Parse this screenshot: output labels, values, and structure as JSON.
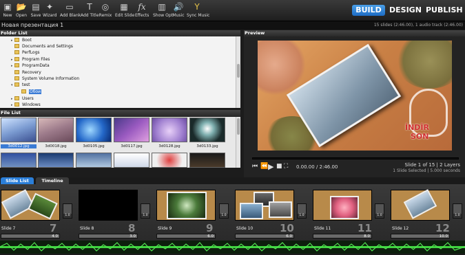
{
  "toolbar": {
    "buttons": [
      {
        "label": "New",
        "icon": "new-icon"
      },
      {
        "label": "Open",
        "icon": "open-icon"
      },
      {
        "label": "Save",
        "icon": "save-icon"
      },
      {
        "label": "Wizard",
        "icon": "wizard-icon"
      },
      {
        "label": "Add Blank",
        "icon": "add-blank-icon"
      },
      {
        "label": "Add Title",
        "icon": "add-title-icon"
      },
      {
        "label": "Remix",
        "icon": "remix-icon"
      },
      {
        "label": "Edit Slide",
        "icon": "edit-slide-icon"
      },
      {
        "label": "Effects",
        "icon": "effects-icon"
      },
      {
        "label": "Show Opt",
        "icon": "show-options-icon"
      },
      {
        "label": "Music",
        "icon": "music-icon"
      },
      {
        "label": "Sync Music",
        "icon": "sync-music-icon"
      }
    ],
    "modes": [
      {
        "label": "BUILD",
        "active": true
      },
      {
        "label": "DESIGN",
        "active": false
      },
      {
        "label": "PUBLISH",
        "active": false
      }
    ]
  },
  "project": {
    "title": "Новая презентация 1",
    "summary": "15 slides (2:46.00), 1 audio track (2:46.00)"
  },
  "folder_list": {
    "header": "Folder List",
    "items": [
      {
        "label": "Boot",
        "expandable": true,
        "selected": false
      },
      {
        "label": "Documents and Settings",
        "expandable": false,
        "selected": false
      },
      {
        "label": "PerfLogs",
        "expandable": false,
        "selected": false
      },
      {
        "label": "Program Files",
        "expandable": true,
        "selected": false
      },
      {
        "label": "ProgramData",
        "expandable": true,
        "selected": false
      },
      {
        "label": "Recovery",
        "expandable": false,
        "selected": false
      },
      {
        "label": "System Volume Information",
        "expandable": false,
        "selected": false
      },
      {
        "label": "test",
        "expandable": true,
        "selected": false
      },
      {
        "label": "Обои",
        "expandable": false,
        "selected": true
      },
      {
        "label": "Users",
        "expandable": true,
        "selected": false
      },
      {
        "label": "Windows",
        "expandable": true,
        "selected": false
      }
    ]
  },
  "file_list": {
    "header": "File List",
    "files": [
      {
        "name": "3d0012.jpg",
        "selected": true
      },
      {
        "name": "3d0018.jpg",
        "selected": false
      },
      {
        "name": "3d0105.jpg",
        "selected": false
      },
      {
        "name": "3d0117.jpg",
        "selected": false
      },
      {
        "name": "3d0128.jpg",
        "selected": false
      },
      {
        "name": "3d0133.jpg",
        "selected": false
      }
    ]
  },
  "preview": {
    "header": "Preview",
    "watermark_line1": "İNDİR",
    "watermark_line2": "SON",
    "time": "0.00.00 / 2:46.00",
    "slide_info": "Slide 1 of 15  |  2 Layers",
    "selection_info": "1 Slide Selected  |  5.000 seconds"
  },
  "tabs": [
    {
      "label": "Slide List",
      "active": true
    },
    {
      "label": "Timeline",
      "active": false
    }
  ],
  "slides": [
    {
      "name": "Slide 7",
      "num": "7",
      "duration": "4.0",
      "transition": "1.0"
    },
    {
      "name": "Slide 8",
      "num": "8",
      "duration": "3.0",
      "transition": "1.0"
    },
    {
      "name": "Slide 9",
      "num": "9",
      "duration": "6.0",
      "transition": "1.0"
    },
    {
      "name": "Slide 10",
      "num": "10",
      "duration": "6.0",
      "transition": "1.0"
    },
    {
      "name": "Slide 11",
      "num": "11",
      "duration": "8.0",
      "transition": "1.0"
    },
    {
      "name": "Slide 12",
      "num": "12",
      "duration": "10.0",
      "transition": "1.0"
    }
  ],
  "colors": {
    "accent": "#2b7fd9",
    "panel": "#2a2a2a",
    "waveform": "#3fd43f"
  }
}
